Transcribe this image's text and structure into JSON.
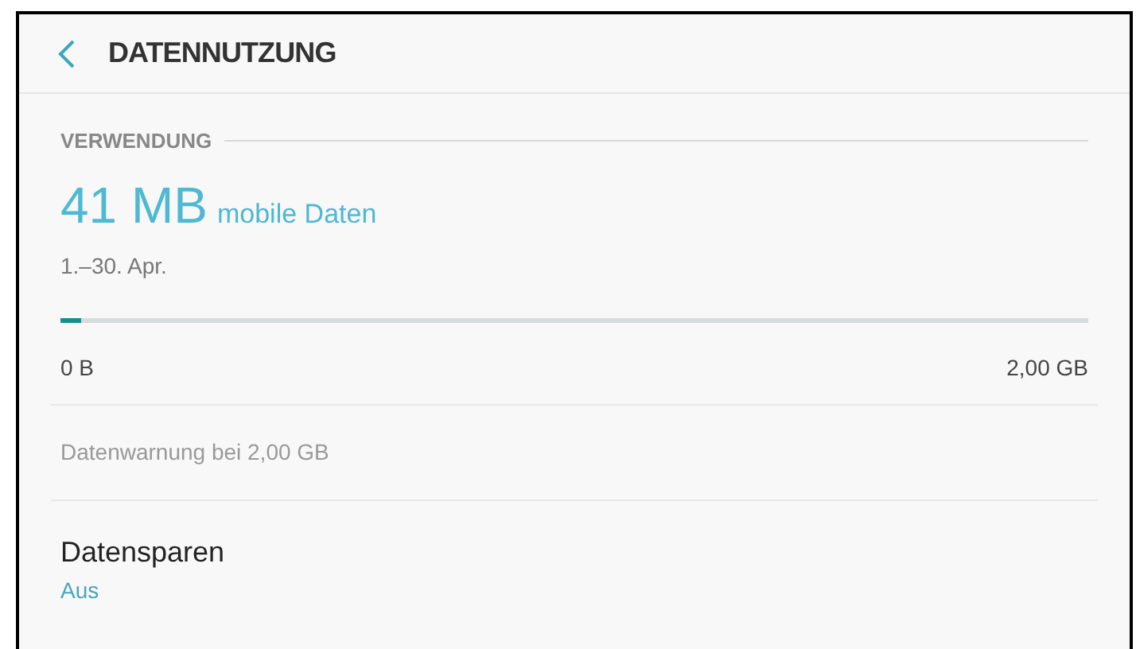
{
  "header": {
    "title": "DATENNUTZUNG"
  },
  "usage": {
    "section": "VERWENDUNG",
    "amount": "41 MB",
    "amount_label": "mobile Daten",
    "period": "1.–30. Apr.",
    "level": 0.02,
    "min_label": "0 B",
    "max_label": "2,00 GB"
  },
  "warning": "Datenwarnung bei 2,00 GB",
  "data_saver": {
    "title": "Datensparen",
    "value": "Aus"
  }
}
